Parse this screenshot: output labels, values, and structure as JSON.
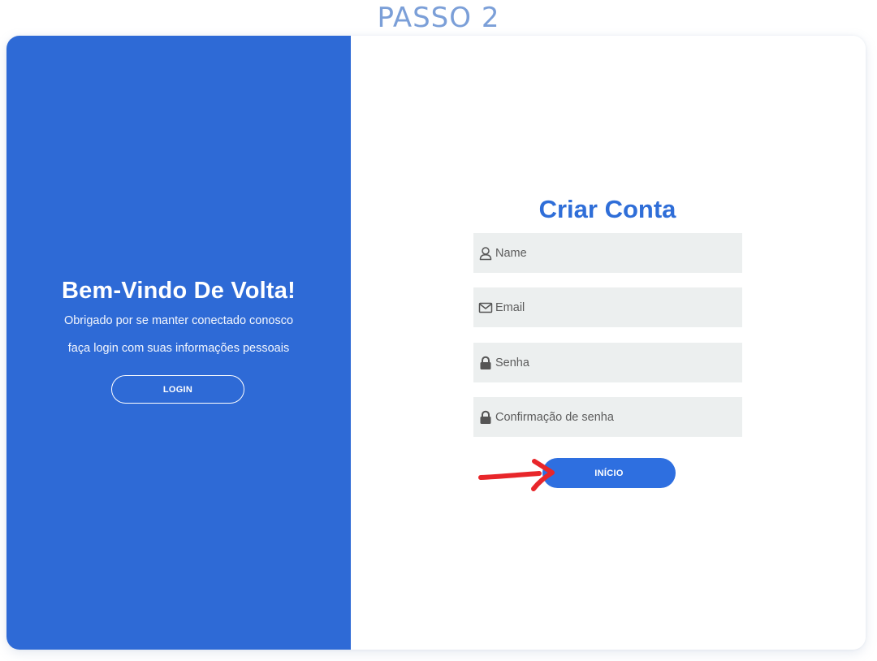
{
  "step": {
    "title": "PASSO 2"
  },
  "left": {
    "title": "Bem-Vindo De Volta!",
    "line1": "Obrigado por se manter conectado conosco",
    "line2": "faça login com suas informações pessoais",
    "login_label": "LOGIN"
  },
  "form": {
    "title": "Criar Conta",
    "fields": [
      {
        "placeholder": "Name",
        "icon": "user-icon"
      },
      {
        "placeholder": "Email",
        "icon": "envelope-icon"
      },
      {
        "placeholder": "Senha",
        "icon": "lock-icon"
      },
      {
        "placeholder": "Confirmação de senha",
        "icon": "lock-icon"
      }
    ],
    "submit_label": "INÍCIO"
  },
  "annotation": {
    "arrow_color": "#e8262a"
  },
  "colors": {
    "accent": "#2e6ad6",
    "title_blue": "#2f6ed8",
    "step_blue": "#7b9fd8",
    "field_bg": "#ecefef"
  }
}
